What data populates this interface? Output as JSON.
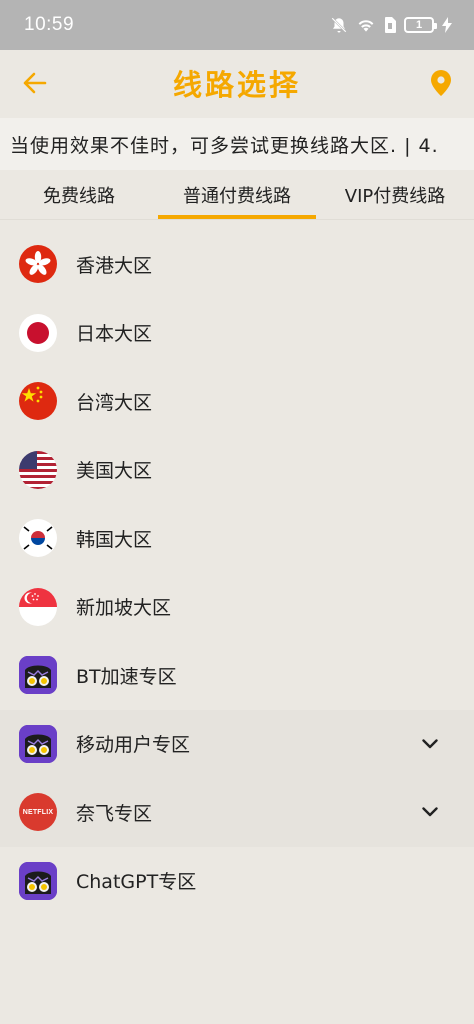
{
  "status_bar": {
    "time": "10:59",
    "battery": "1"
  },
  "header": {
    "title": "线路选择"
  },
  "notice": {
    "text": "当使用效果不佳时，可多尝试更换线路大区. | 4."
  },
  "tabs": [
    {
      "label": "免费线路"
    },
    {
      "label": "普通付费线路"
    },
    {
      "label": "VIP付费线路"
    }
  ],
  "regions": [
    {
      "label": "香港大区",
      "icon": "hong-kong-flag"
    },
    {
      "label": "日本大区",
      "icon": "japan-flag"
    },
    {
      "label": "台湾大区",
      "icon": "china-flag"
    },
    {
      "label": "美国大区",
      "icon": "usa-flag"
    },
    {
      "label": "韩国大区",
      "icon": "korea-flag"
    },
    {
      "label": "新加坡大区",
      "icon": "singapore-flag"
    },
    {
      "label": "BT加速专区",
      "icon": "app-mascot"
    },
    {
      "label": "移动用户专区",
      "icon": "app-mascot"
    },
    {
      "label": "奈飞专区",
      "icon": "netflix-logo",
      "icon_text": "NETFLIX"
    },
    {
      "label": "ChatGPT专区",
      "icon": "app-mascot"
    }
  ],
  "colors": {
    "accent": "#f5a800",
    "background": "#ebe8e2",
    "statusbar": "#b4b4b4",
    "app_icon": "#6a3fc7",
    "netflix": "#d93a2e"
  }
}
